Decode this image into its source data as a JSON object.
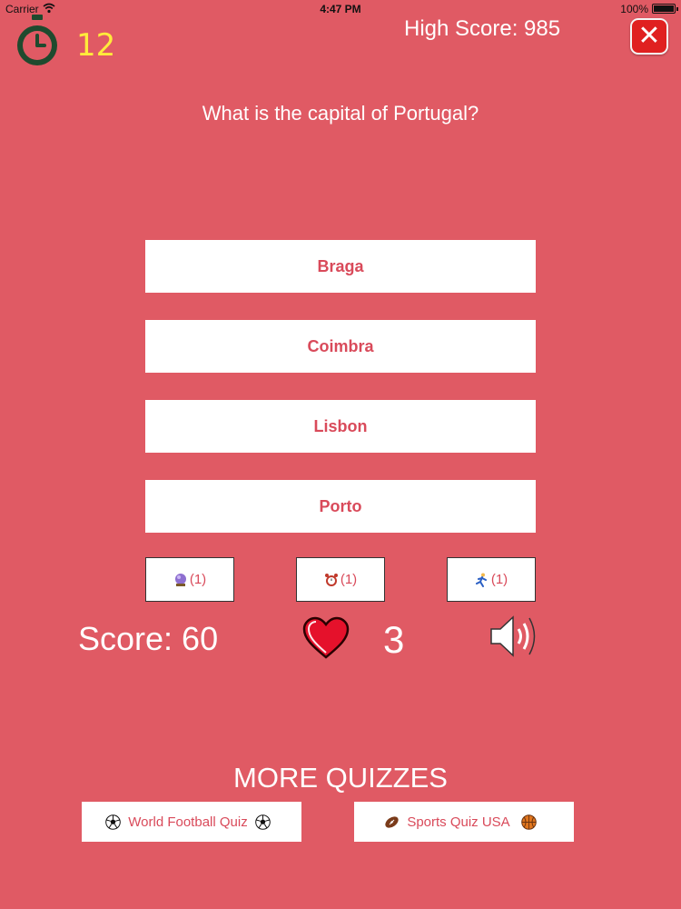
{
  "status_bar": {
    "carrier": "Carrier",
    "time": "4:47 PM",
    "battery": "100%"
  },
  "header": {
    "timer_value": "12",
    "high_score": "High Score: 985"
  },
  "question": "What is the capital of Portugal?",
  "answers": [
    "Braga",
    "Coimbra",
    "Lisbon",
    "Porto"
  ],
  "lifelines": [
    {
      "icon": "crystal-ball-icon",
      "count": "(1)"
    },
    {
      "icon": "alarm-clock-icon",
      "count": "(1)"
    },
    {
      "icon": "runner-icon",
      "count": "(1)"
    }
  ],
  "score": "Score: 60",
  "lives": "3",
  "more_quizzes": {
    "title": "MORE QUIZZES",
    "links": [
      {
        "label": "World Football Quiz",
        "icon_left": "soccer-ball-icon",
        "icon_right": "soccer-ball-icon"
      },
      {
        "label": "Sports Quiz USA",
        "icon_left": "american-football-icon",
        "icon_right": "basketball-icon"
      }
    ]
  },
  "colors": {
    "background": "#e05a64",
    "accent_text": "#d94a5a",
    "timer": "#ffeb3b",
    "close_button": "#e02020"
  }
}
